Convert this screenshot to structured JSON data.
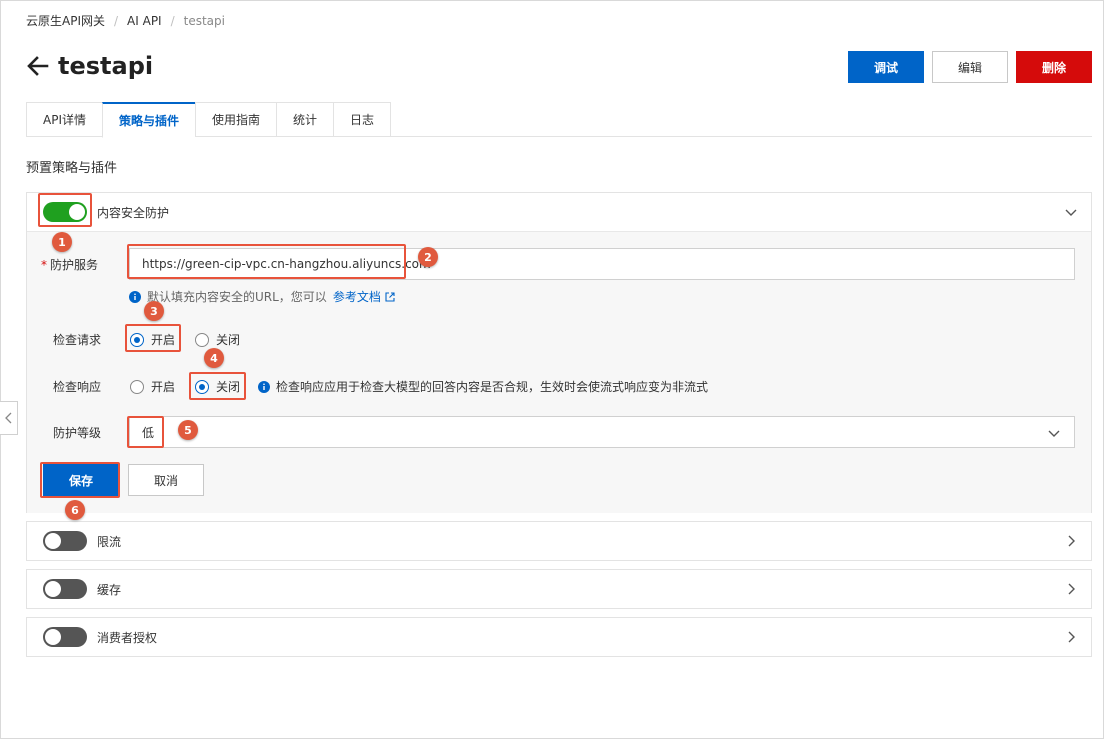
{
  "breadcrumb": [
    "云原生API网关",
    "AI API",
    "testapi"
  ],
  "page_title": "testapi",
  "actions": {
    "debug": "调试",
    "edit": "编辑",
    "delete": "删除"
  },
  "tabs": [
    "API详情",
    "策略与插件",
    "使用指南",
    "统计",
    "日志"
  ],
  "active_tab": "策略与插件",
  "section_title": "预置策略与插件",
  "content_safety": {
    "label": "内容安全防护",
    "enabled": true,
    "service_label": "防护服务",
    "service_value": "https://green-cip-vpc.cn-hangzhou.aliyuncs.com",
    "hint_text": "默认填充内容安全的URL，您可以",
    "hint_link": "参考文档",
    "check_request_label": "检查请求",
    "check_response_label": "检查响应",
    "option_on": "开启",
    "option_off": "关闭",
    "check_request_value": "开启",
    "check_response_value": "关闭",
    "response_hint": "检查响应应用于检查大模型的回答内容是否合规，生效时会使流式响应变为非流式",
    "level_label": "防护等级",
    "level_value": "低",
    "save": "保存",
    "cancel": "取消"
  },
  "plugins": [
    {
      "label": "限流",
      "enabled": false
    },
    {
      "label": "缓存",
      "enabled": false
    },
    {
      "label": "消费者授权",
      "enabled": false
    }
  ],
  "steps": [
    "1",
    "2",
    "3",
    "4",
    "5",
    "6"
  ],
  "colors": {
    "primary": "#0064c8",
    "danger": "#d50b0b",
    "switch_on": "#1fa01f",
    "annotation": "#e8533b"
  }
}
